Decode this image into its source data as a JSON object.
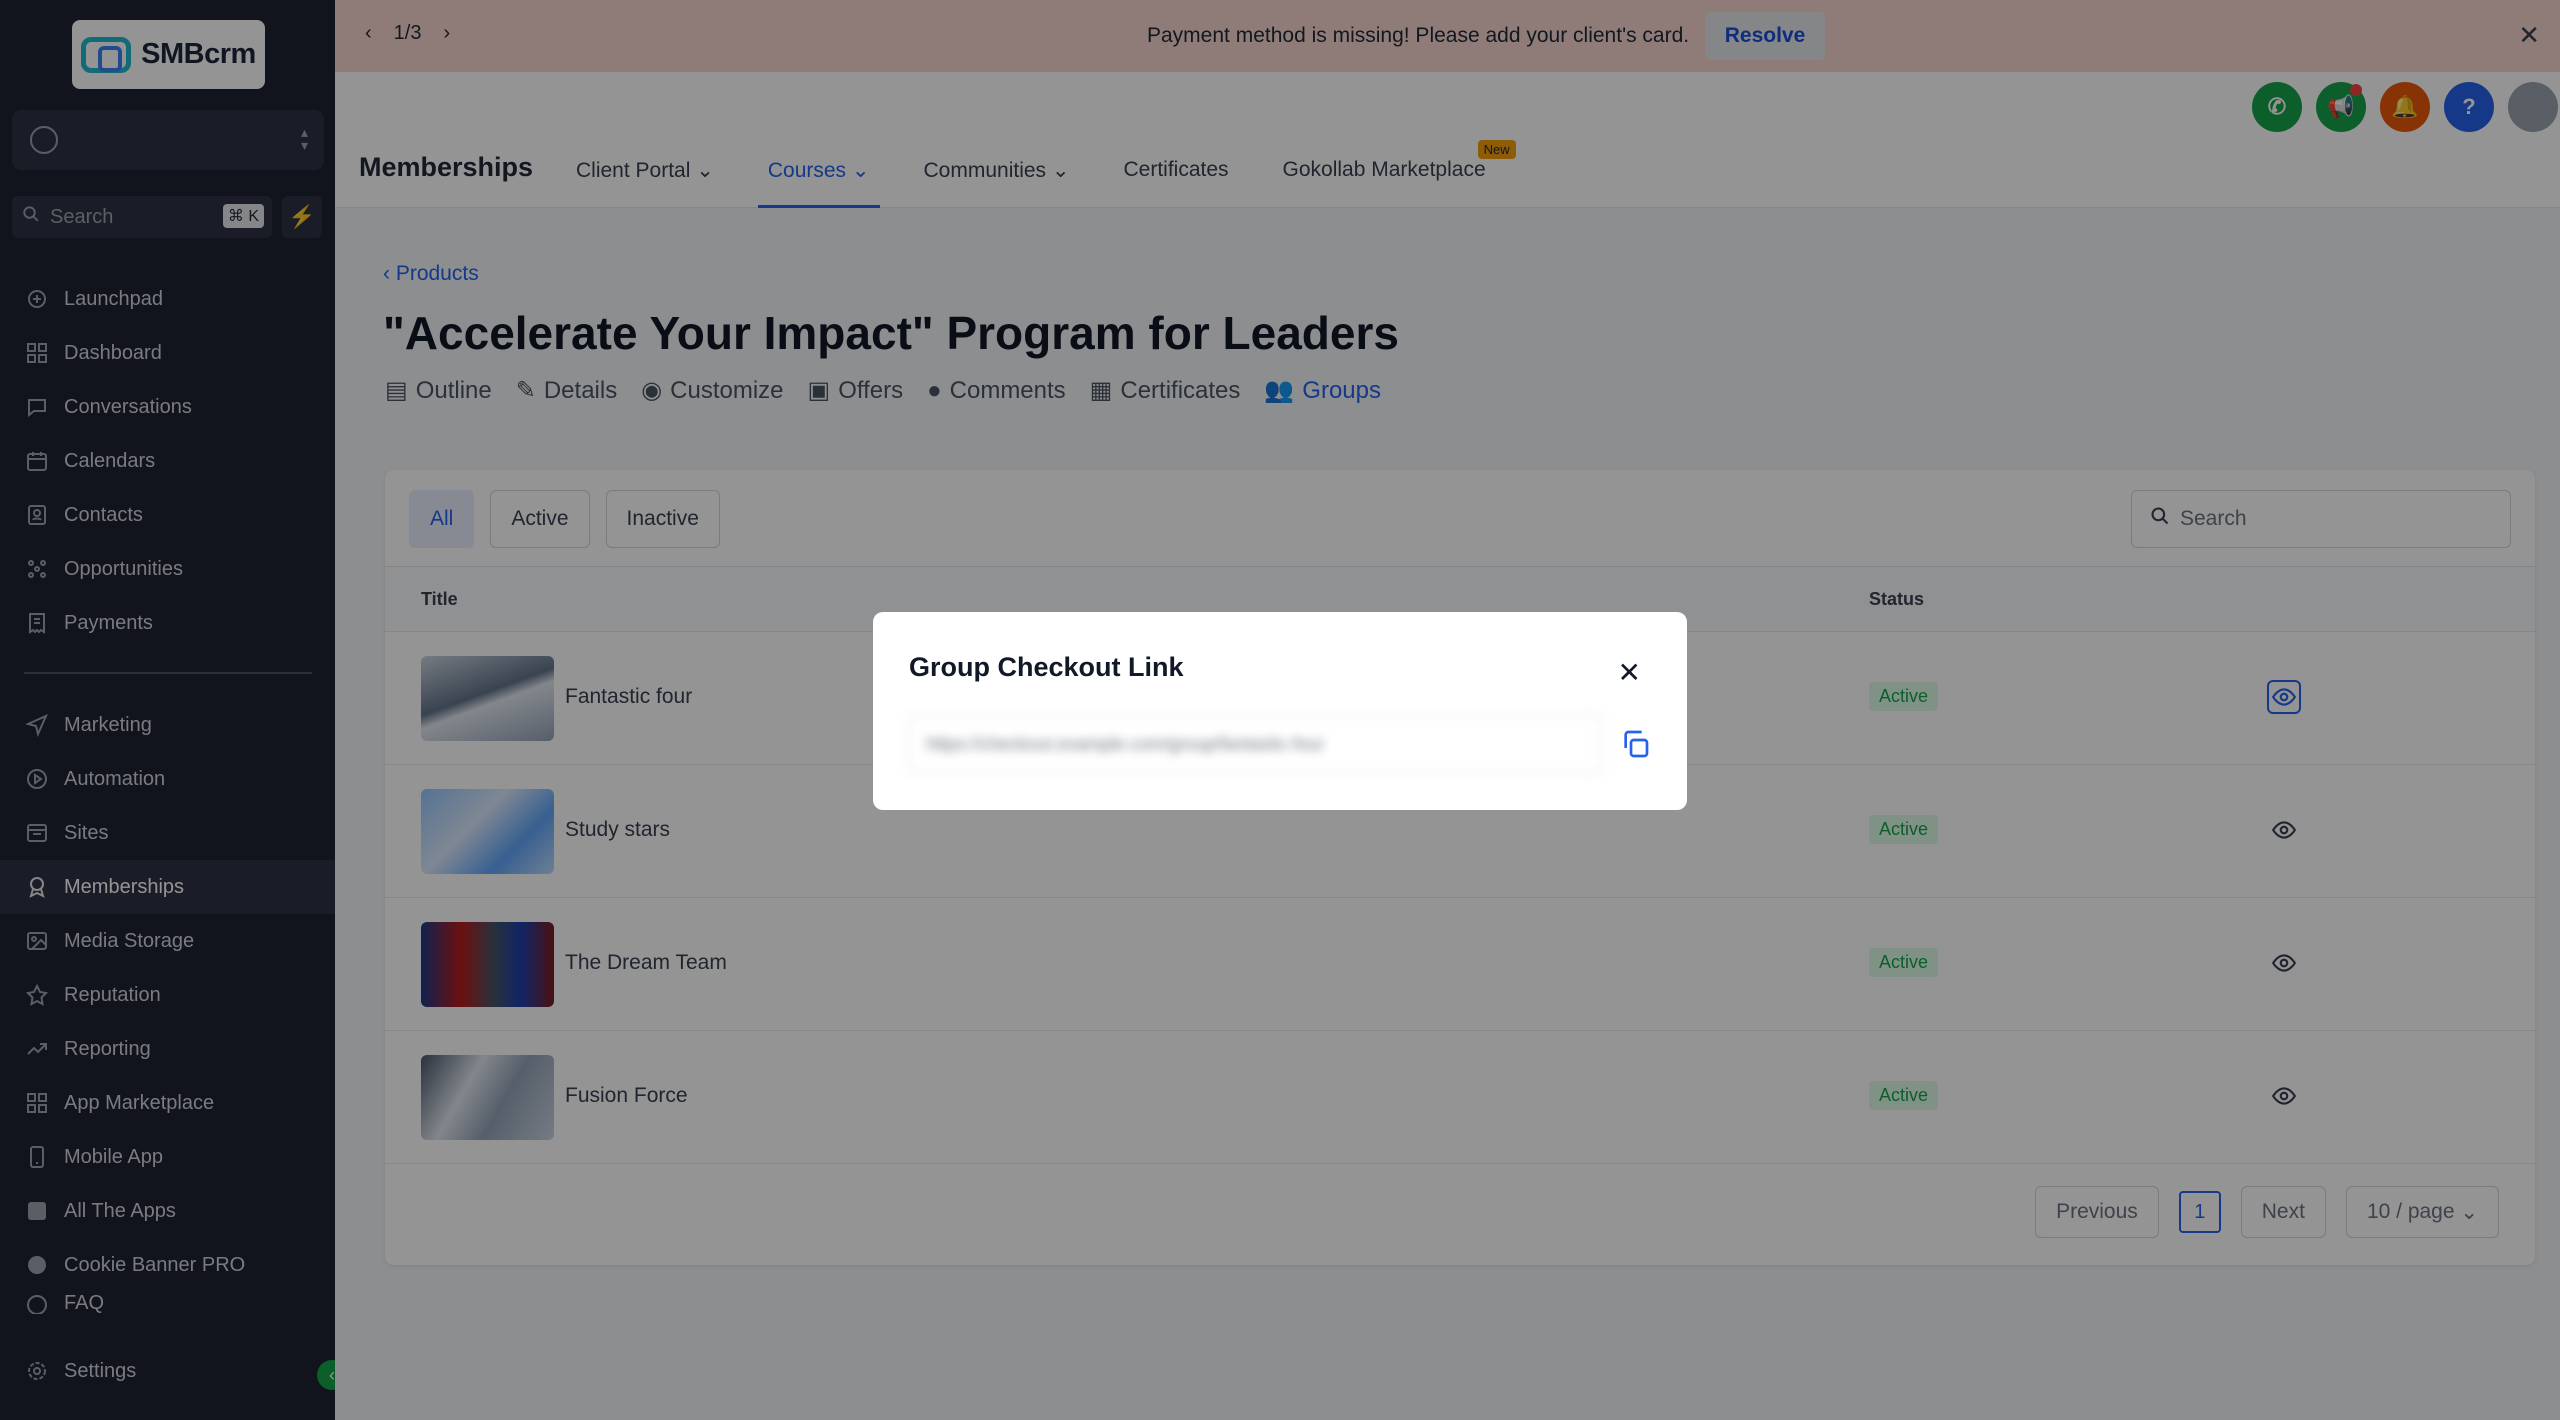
{
  "app": {
    "logo_text": "SMBcrm"
  },
  "sidebar": {
    "search_placeholder": "Search",
    "search_shortcut": "⌘ K",
    "items": [
      {
        "label": "Launchpad"
      },
      {
        "label": "Dashboard"
      },
      {
        "label": "Conversations"
      },
      {
        "label": "Calendars"
      },
      {
        "label": "Contacts"
      },
      {
        "label": "Opportunities"
      },
      {
        "label": "Payments"
      },
      {
        "label": "Marketing"
      },
      {
        "label": "Automation"
      },
      {
        "label": "Sites"
      },
      {
        "label": "Memberships",
        "active": true
      },
      {
        "label": "Media Storage"
      },
      {
        "label": "Reputation"
      },
      {
        "label": "Reporting"
      },
      {
        "label": "App Marketplace"
      },
      {
        "label": "Mobile App"
      },
      {
        "label": "All The Apps"
      },
      {
        "label": "Cookie Banner PRO"
      },
      {
        "label": "FAQ"
      }
    ],
    "settings_label": "Settings"
  },
  "banner": {
    "pager": "1/3",
    "message": "Payment method is missing! Please add your client's card.",
    "resolve_label": "Resolve"
  },
  "header": {
    "title": "Memberships",
    "tabs": [
      {
        "label": "Client Portal",
        "dropdown": true
      },
      {
        "label": "Courses",
        "dropdown": true,
        "active": true
      },
      {
        "label": "Communities",
        "dropdown": true
      },
      {
        "label": "Certificates"
      },
      {
        "label": "Gokollab Marketplace",
        "badge": "New"
      }
    ],
    "icons": [
      {
        "name": "phone-icon",
        "color": "#16a34a"
      },
      {
        "name": "megaphone-icon",
        "color": "#16a34a"
      },
      {
        "name": "bell-icon",
        "color": "#ea580c"
      },
      {
        "name": "help-icon",
        "color": "#2563eb"
      },
      {
        "name": "avatar",
        "color": "#9ca3af"
      }
    ]
  },
  "product": {
    "breadcrumb": "Products",
    "title": "\"Accelerate Your Impact\" Program for Leaders",
    "tabs": [
      {
        "label": "Outline"
      },
      {
        "label": "Details"
      },
      {
        "label": "Customize"
      },
      {
        "label": "Offers"
      },
      {
        "label": "Comments"
      },
      {
        "label": "Certificates"
      },
      {
        "label": "Groups",
        "active": true
      }
    ]
  },
  "groups": {
    "filters": [
      {
        "label": "All",
        "active": true
      },
      {
        "label": "Active"
      },
      {
        "label": "Inactive"
      }
    ],
    "search_placeholder": "Search",
    "columns": {
      "title": "Title",
      "status": "Status"
    },
    "rows": [
      {
        "title": "Fantastic four",
        "status": "Active"
      },
      {
        "title": "Study stars",
        "status": "Active"
      },
      {
        "title": "The Dream Team",
        "status": "Active"
      },
      {
        "title": "Fusion Force",
        "status": "Active"
      }
    ],
    "pagination": {
      "previous": "Previous",
      "page": "1",
      "next": "Next",
      "page_size": "10 / page"
    }
  },
  "modal": {
    "title": "Group Checkout Link",
    "link_value": "https://checkout.example.com/group/fantastic-four"
  }
}
